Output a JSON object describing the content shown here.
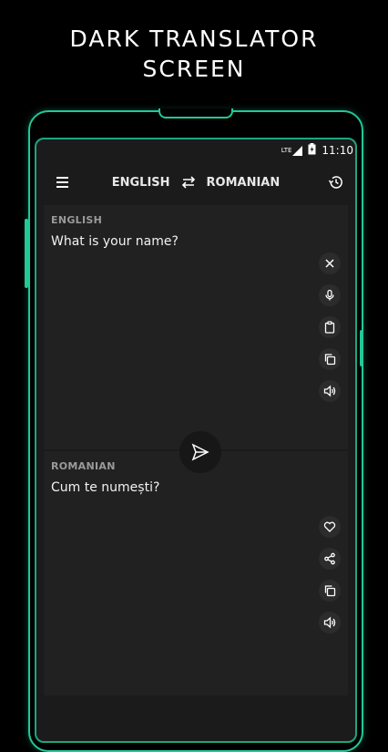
{
  "promo": {
    "headline_line1": "DARK TRANSLATOR",
    "headline_line2": "SCREEN"
  },
  "status_bar": {
    "network": "LTE",
    "time": "11:10"
  },
  "toolbar": {
    "source_language": "ENGLISH",
    "target_language": "ROMANIAN"
  },
  "source_panel": {
    "label": "ENGLISH",
    "text": "What is your name?"
  },
  "target_panel": {
    "label": "ROMANIAN",
    "text": "Cum te numești?"
  },
  "colors": {
    "accent": "#21c997",
    "background": "#000000",
    "panel": "#212121",
    "screen": "#1b1b1b"
  },
  "icons": {
    "toolbar": [
      "menu-icon",
      "swap-icon",
      "history-icon"
    ],
    "source_actions": [
      "close-icon",
      "microphone-icon",
      "clipboard-icon",
      "copy-icon",
      "speaker-icon"
    ],
    "target_actions": [
      "heart-icon",
      "share-icon",
      "copy-icon",
      "speaker-icon"
    ],
    "send": "send-icon"
  }
}
